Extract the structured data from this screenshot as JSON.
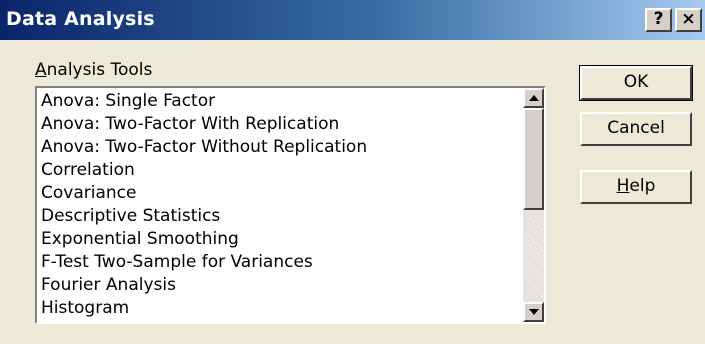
{
  "window": {
    "title": "Data Analysis",
    "help_glyph": "?",
    "close_glyph": "×"
  },
  "analysis_tools": {
    "label_accel": "A",
    "label_rest": "nalysis Tools",
    "items": [
      "Anova: Single Factor",
      "Anova: Two-Factor With Replication",
      "Anova: Two-Factor Without Replication",
      "Correlation",
      "Covariance",
      "Descriptive Statistics",
      "Exponential Smoothing",
      "F-Test Two-Sample for Variances",
      "Fourier Analysis",
      "Histogram"
    ]
  },
  "buttons": {
    "ok": "OK",
    "cancel": "Cancel",
    "help_accel": "H",
    "help_rest": "elp"
  },
  "colors": {
    "title_start": "#0a246a",
    "title_end": "#a6caf0",
    "face": "#ece9d8"
  },
  "icons": {
    "scroll_up": "arrow-up",
    "scroll_down": "arrow-down"
  }
}
